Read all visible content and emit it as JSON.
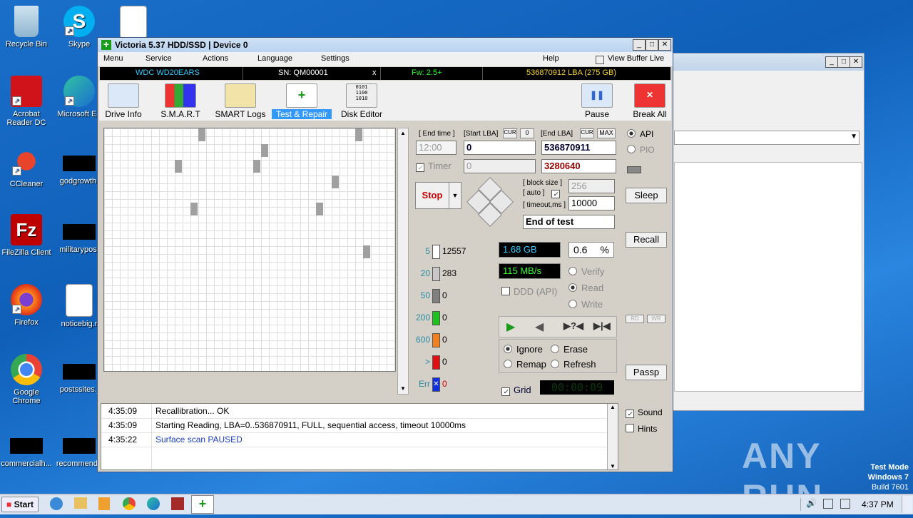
{
  "desktop": {
    "icons": [
      {
        "label": "Recycle Bin"
      },
      {
        "label": "Skype"
      },
      {
        "label": "Acrobat Reader DC"
      },
      {
        "label": "Microsoft Ed"
      },
      {
        "label": "CCleaner"
      },
      {
        "label": "godgrowth."
      },
      {
        "label": "FileZilla Client"
      },
      {
        "label": "militarypost"
      },
      {
        "label": "Firefox"
      },
      {
        "label": "noticebig.r"
      },
      {
        "label": "Google Chrome"
      },
      {
        "label": "postssites.j"
      },
      {
        "label": "commercialh..."
      },
      {
        "label": "recommende"
      }
    ],
    "watermark": "ANY RUN",
    "os_info": {
      "line1": "Test Mode",
      "line2": "Windows 7",
      "line3": "Build 7601"
    }
  },
  "window": {
    "title": "Victoria 5.37 HDD/SSD | Device 0",
    "menu": [
      "Menu",
      "Service",
      "Actions",
      "Language",
      "Settings",
      "Help",
      "View Buffer Live"
    ],
    "info": {
      "model": "WDC WD20EARS",
      "serial": "SN: QM00001",
      "close": "x",
      "firmware": "Fw: 2.5+",
      "lba": "536870912 LBA (275 GB)"
    },
    "toolbar": [
      "Drive Info",
      "S.M.A.R.T",
      "SMART Logs",
      "Test & Repair",
      "Disk Editor"
    ],
    "pause_label": "Pause",
    "break_label": "Break All"
  },
  "controls": {
    "end_time_label": "[ End time ]",
    "start_lba_label": "[Start LBA]",
    "cur_label": "CUR",
    "zero_label": "0",
    "end_lba_label": "[End LBA]",
    "max_label": "MAX",
    "time_value": "12:00",
    "start_lba": "0",
    "end_lba": "536870911",
    "timer_label": "Timer",
    "timer_value": "0",
    "lba_pos": "3280640",
    "stop_label": "Stop",
    "block_size_label": "[ block size ]",
    "auto_label": "[ auto ]",
    "block_size": "256",
    "timeout_label": "[ timeout,ms ]",
    "timeout": "10000",
    "end_action": "End of test"
  },
  "stats": {
    "legend": [
      {
        "label": "5",
        "count": "12557",
        "color": "#ffffff"
      },
      {
        "label": "20",
        "count": "283",
        "color": "#c8c8c8"
      },
      {
        "label": "50",
        "count": "0",
        "color": "#808080"
      },
      {
        "label": "200",
        "count": "0",
        "color": "#20c020"
      },
      {
        "label": "600",
        "count": "0",
        "color": "#f08020"
      },
      {
        "label": ">",
        "count": "0",
        "color": "#e01010"
      },
      {
        "label": "Err",
        "count": "0",
        "color": "#1030e0"
      }
    ],
    "size_done": "1.68 GB",
    "percent": "0.6",
    "percent_sign": "%",
    "speed": "115 MB/s",
    "ddd_label": "DDD (API)",
    "verify_label": "Verify",
    "read_label": "Read",
    "write_label": "Write",
    "ignore_label": "Ignore",
    "erase_label": "Erase",
    "remap_label": "Remap",
    "refresh_label": "Refresh",
    "grid_label": "Grid",
    "elapsed": "00:00:09"
  },
  "side": {
    "api": "API",
    "pio": "PIO",
    "sleep": "Sleep",
    "recall": "Recall",
    "rd": "RD",
    "wr": "WR",
    "passp": "Passp",
    "sound": "Sound",
    "hints": "Hints"
  },
  "log": [
    {
      "time": "4:35:09",
      "msg": "Recallibration... OK",
      "color": "#000000"
    },
    {
      "time": "4:35:09",
      "msg": "Starting Reading, LBA=0..536870911, FULL, sequential access, timeout 10000ms",
      "color": "#000000"
    },
    {
      "time": "4:35:22",
      "msg": "Surface scan PAUSED",
      "color": "#1a3fc0"
    }
  ],
  "taskbar": {
    "start": "Start",
    "clock": "4:37 PM"
  },
  "colors": {
    "accent": "#3399ff",
    "lcd_text": "#33ccff",
    "stop_text": "#cc0000"
  }
}
